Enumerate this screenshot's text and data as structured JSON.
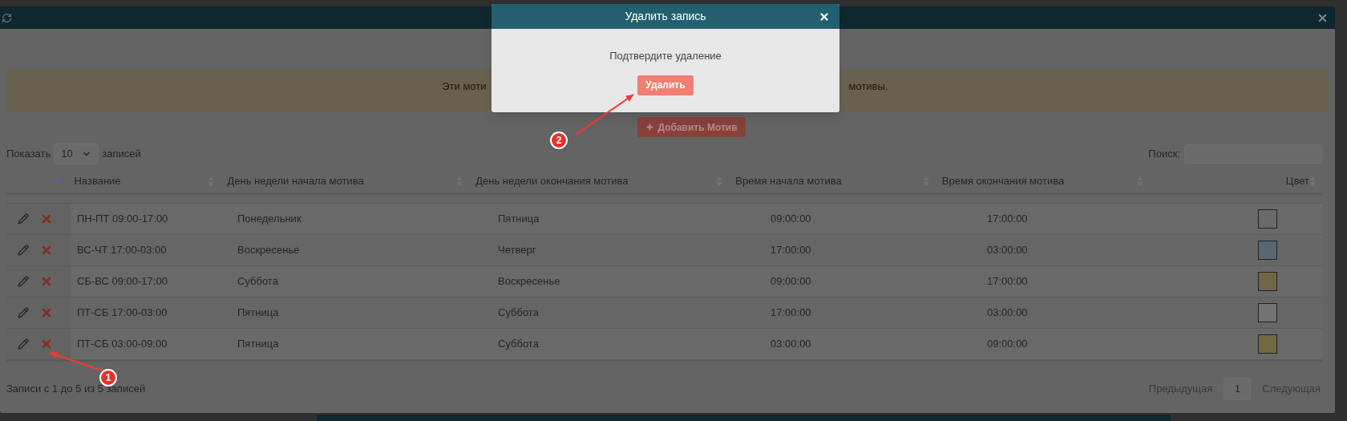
{
  "dialog": {
    "title": "Удалить запись",
    "message": "Подтвердите удаление",
    "confirm_button": "Удалить"
  },
  "alert": {
    "text_left": "Эти моти",
    "text_right": "мотивы."
  },
  "add_button": "Добавить Мотив",
  "length": {
    "label_before": "Показать",
    "value": "10",
    "label_after": "записей"
  },
  "search": {
    "label": "Поиск:"
  },
  "table": {
    "actions_column": {
      "sorted": true
    },
    "columns": [
      {
        "label": "Название",
        "sorted": false
      },
      {
        "label": "День недели начала мотива",
        "sorted": false
      },
      {
        "label": "День недели окончания мотива",
        "sorted": false
      },
      {
        "label": "Время начала мотива",
        "sorted": false
      },
      {
        "label": "Время окончания мотива",
        "sorted": false
      },
      {
        "label": "Цвет",
        "sorted": false
      }
    ],
    "rows": [
      {
        "name": "ПН-ПТ 09:00-17:00",
        "day_start": "Понедельник",
        "day_end": "Пятница",
        "time_start": "09:00:00",
        "time_end": "17:00:00",
        "color": "#6a6a6a"
      },
      {
        "name": "ВС-ЧТ 17:00-03:00",
        "day_start": "Воскресенье",
        "day_end": "Четверг",
        "time_start": "17:00:00",
        "time_end": "03:00:00",
        "color": "#5a6670"
      },
      {
        "name": "СБ-ВС 09:00-17:00",
        "day_start": "Суббота",
        "day_end": "Воскресенье",
        "time_start": "09:00:00",
        "time_end": "17:00:00",
        "color": "#6f6547"
      },
      {
        "name": "ПТ-СБ 17:00-03:00",
        "day_start": "Пятница",
        "day_end": "Суббота",
        "time_start": "17:00:00",
        "time_end": "03:00:00",
        "color": "#737373"
      },
      {
        "name": "ПТ-СБ 03:00-09:00",
        "day_start": "Пятница",
        "day_end": "Суббота",
        "time_start": "03:00:00",
        "time_end": "09:00:00",
        "color": "#726a3f"
      }
    ]
  },
  "info": "Записи с 1 до 5 из 5 записей",
  "pagination": {
    "previous": "Предыдущая",
    "page": "1",
    "next": "Следующая"
  },
  "annotations": [
    {
      "number": "1"
    },
    {
      "number": "2"
    }
  ]
}
